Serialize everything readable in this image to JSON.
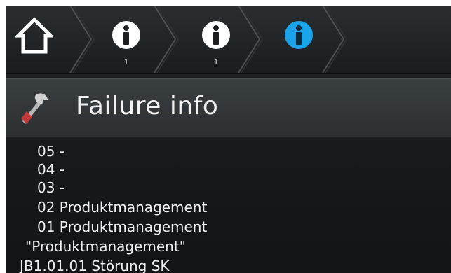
{
  "breadcrumbs": [
    {
      "icon": "home-icon"
    },
    {
      "icon": "info-icon",
      "count": "1",
      "color": "#ffffff"
    },
    {
      "icon": "info-icon",
      "count": "1",
      "color": "#ffffff"
    },
    {
      "icon": "info-icon",
      "count": "",
      "color": "#1aa3e8"
    }
  ],
  "header": {
    "title": "Failure info",
    "icon": "wrench-icon"
  },
  "failure_list": {
    "lines": [
      "05 -",
      "04 -",
      "03 -",
      "02 Produktmanagement",
      "01 Produktmanagement",
      "\"Produktmanagement\"",
      "JB1.01.01 Störung SK"
    ]
  },
  "colors": {
    "accent": "#1aa3e8",
    "background": "#1a1d1f",
    "text": "#f0f0f0"
  }
}
